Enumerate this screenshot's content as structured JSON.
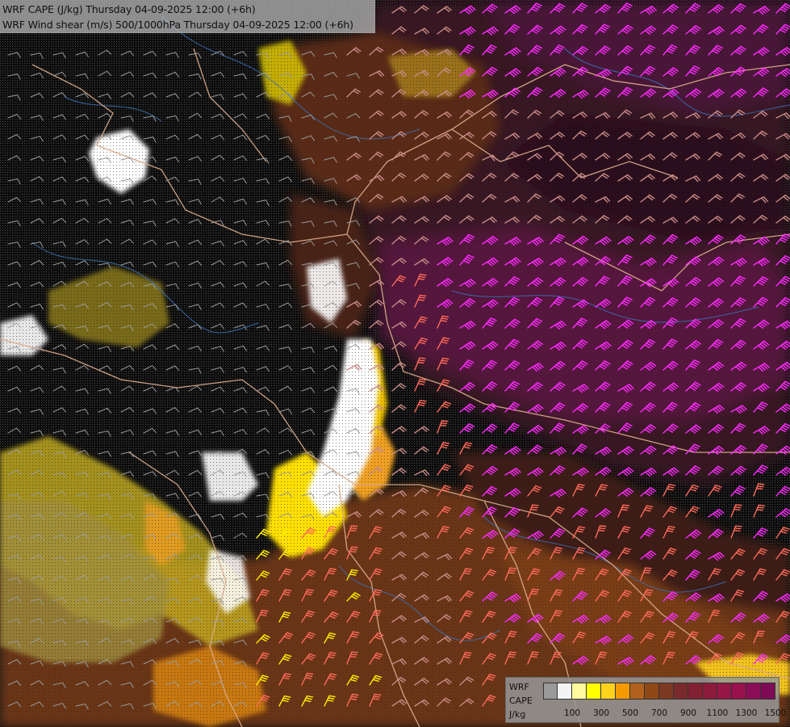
{
  "header": {
    "title_1": "WRF CAPE (J/kg) Thursday 04-09-2025 12:00 (+6h)",
    "title_2": "WRF Wind shear (m/s) 500/1000hPa Thursday 04-09-2025 12:00 (+6h)"
  },
  "legend": {
    "label_1": "WRF",
    "label_2": "CAPE",
    "label_3": "J/kg",
    "colors": [
      "#9a9a9a",
      "#f4f4f4",
      "#fffb9c",
      "#ffff00",
      "#ffd21e",
      "#f29a00",
      "#b0621c",
      "#8f4816",
      "#7d3a22",
      "#7a2a2c",
      "#832133",
      "#8c1b3c",
      "#941745",
      "#98114d",
      "#8c0d57",
      "#7f0a55"
    ],
    "ticks": [
      "100",
      "300",
      "500",
      "700",
      "900",
      "1100",
      "1300",
      "1500"
    ]
  },
  "colors": {
    "background": "#000000",
    "stipple": "#3a3a3a",
    "barb_low": "#9a9a9a",
    "barb_mid": "#c78a86",
    "barb_strong": "#ff6a5a",
    "barb_high": "#ff2bff",
    "barb_yellow": "#ffee00",
    "borders": "#d9a98a",
    "rivers": "#3b6fb5",
    "cape_white": "#ffffff",
    "cape_yellow": "#ffec00",
    "cape_orange": "#f0a020",
    "cape_brown": "#7a3c16",
    "cape_maroon": "#5a1530",
    "cape_purple": "#6a0f48"
  }
}
